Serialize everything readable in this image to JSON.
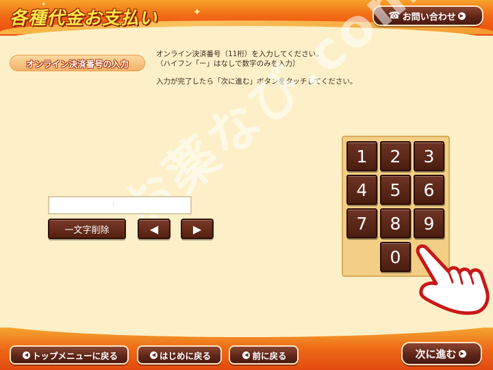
{
  "header": {
    "title": "各種代金お支払い",
    "contact_label": "お問い合わせ"
  },
  "section": {
    "label": "オンライン決済番号の入力"
  },
  "instructions": {
    "line1": "オンライン決済番号（11桁）を入力してください。",
    "line2": "（ハイフン「ー」はなしで数字のみを入力）",
    "line3": "入力が完了したら「次に進む」ボタンをタッチしてください。"
  },
  "input": {
    "value": "",
    "cursor_mark": "⁝"
  },
  "edit_controls": {
    "delete_label": "一文字削除",
    "left_symbol": "◀",
    "right_symbol": "▶"
  },
  "keypad": {
    "keys": [
      "1",
      "2",
      "3",
      "4",
      "5",
      "6",
      "7",
      "8",
      "9",
      "0"
    ]
  },
  "footer": {
    "top_menu_label": "トップメニューに戻る",
    "begin_label": "はじめに戻る",
    "back_label": "前に戻る",
    "next_label": "次に進む"
  },
  "watermark": {
    "text": "お薬なび.com"
  },
  "icons": {
    "contact": "phone-icon",
    "nav_left": "arrow-left-circle-icon",
    "nav_right": "arrow-right-circle-icon",
    "pointer": "pointing-hand-icon"
  },
  "colors": {
    "header_orange": "#f26a16",
    "background": "#fdf0c8",
    "button_brown": "#5c2418",
    "keypad_panel": "#f2cf85",
    "title_yellow": "#ffe74a"
  }
}
